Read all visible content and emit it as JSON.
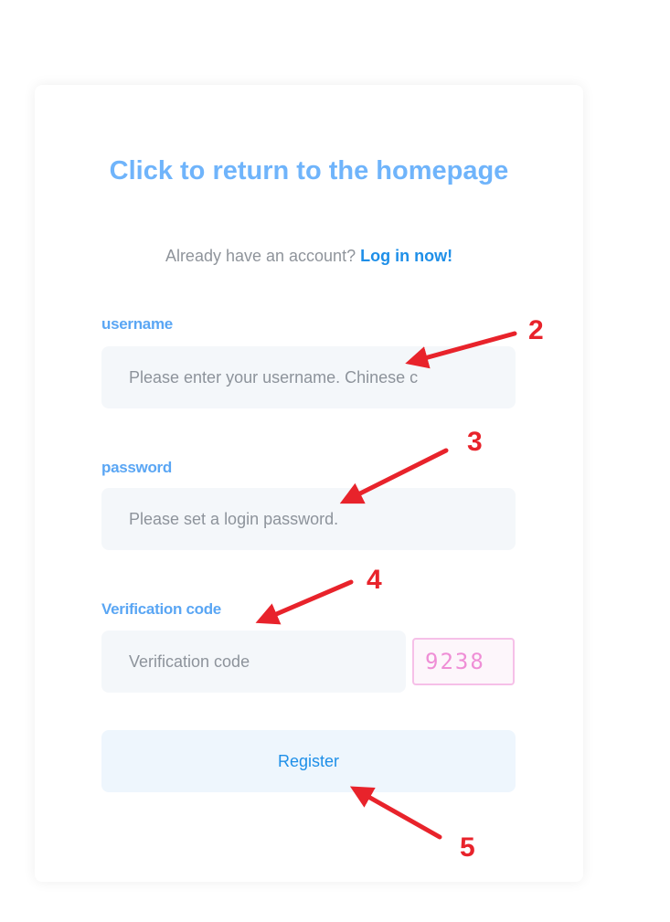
{
  "register_form": {
    "title": "Click to return to the homepage",
    "subtitle_prefix": "Already have an account? ",
    "login_link": "Log in now!",
    "username_label": "username",
    "username_placeholder": "Please enter your username. Chinese c",
    "password_label": "password",
    "password_placeholder": "Please set a login password.",
    "verification_label": "Verification code",
    "verification_placeholder": "Verification code",
    "captcha_text": "9238",
    "register_button": "Register"
  },
  "annotations": {
    "markers": [
      "2",
      "3",
      "4",
      "5"
    ],
    "arrow_color": "#e8232b"
  },
  "colors": {
    "accent": "#6fb4fb",
    "link": "#1e8fe8",
    "field_background": "#f4f7fa",
    "captcha": "#ef8ed6"
  }
}
